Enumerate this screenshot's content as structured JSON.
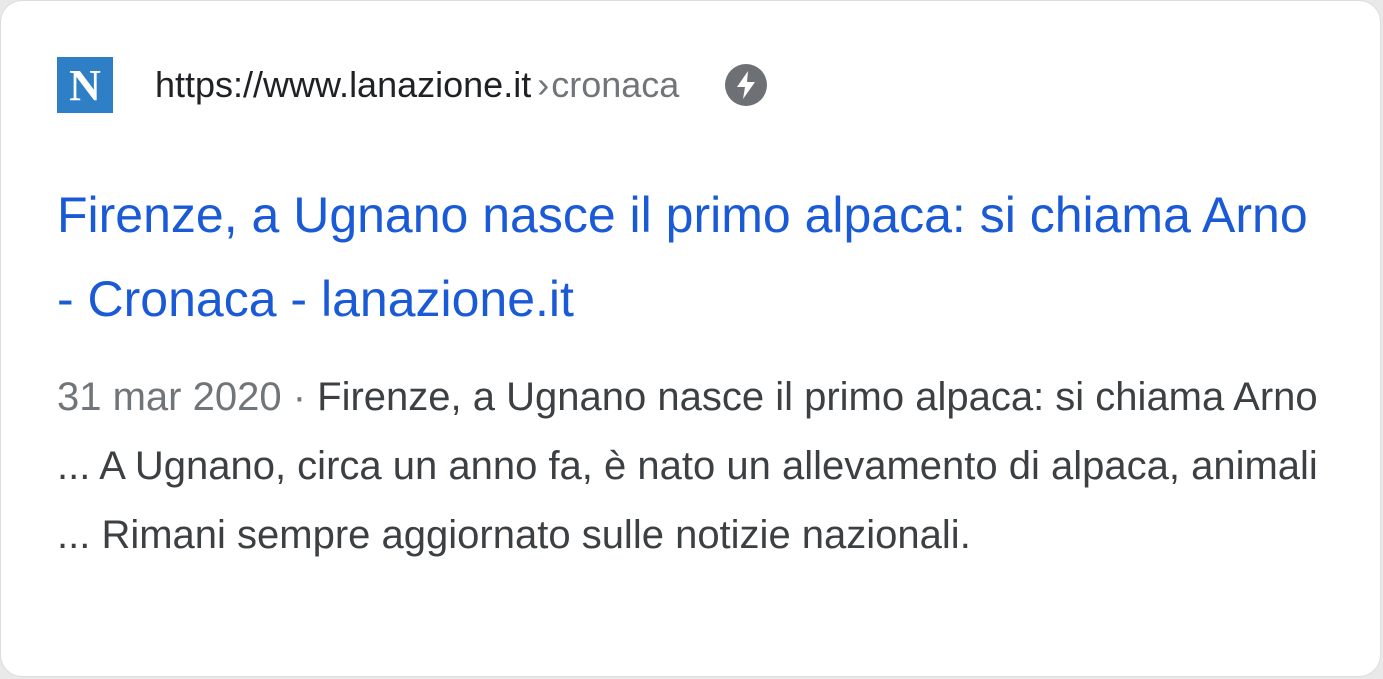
{
  "result": {
    "favicon_letter": "N",
    "favicon_color": "#2f7fc6",
    "url": "https://www.lanazione.it",
    "breadcrumb_separator": "›",
    "breadcrumb": "cronaca",
    "amp_icon": "lightning-bolt-icon",
    "title": "Firenze, a Ugnano nasce il primo alpaca: si chiama Arno - Cronaca - lanazione.it",
    "title_color": "#1a5ad7",
    "date": "31 mar 2020",
    "date_separator": " · ",
    "snippet": "Firenze, a Ugnano nasce il primo alpaca: si chiama Arno ... A Ugnano, circa un anno fa, è nato un allevamento di alpaca, animali ... Rimani sempre aggiornato sulle notizie nazionali."
  }
}
